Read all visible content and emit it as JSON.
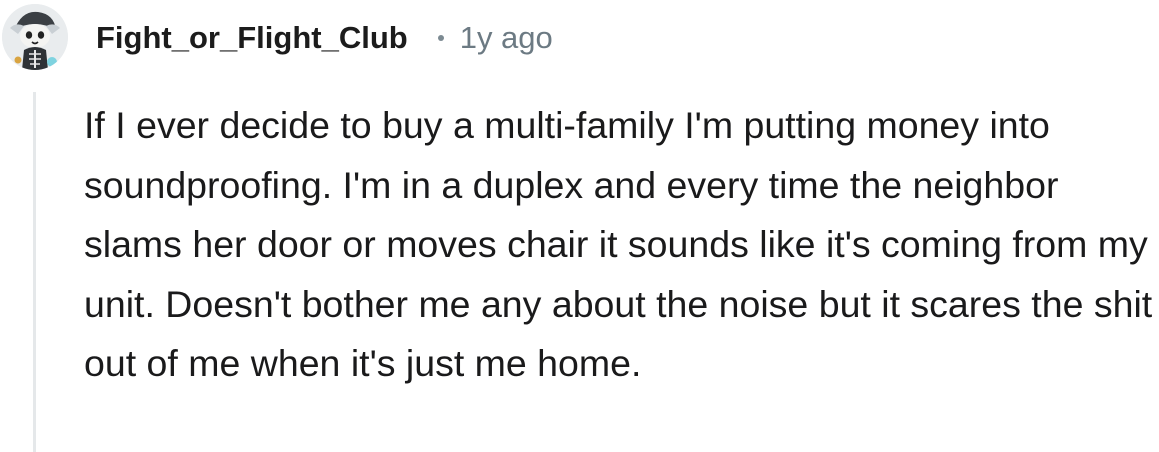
{
  "comment": {
    "username": "Fight_or_Flight_Club",
    "timestamp": "1y ago",
    "avatar_icon": "snoo-avatar-icon",
    "body": "If I ever decide to buy a multi-family I'm putting money into soundproofing. I'm in a duplex and every time the neighbor slams her door or moves chair it sounds like it's coming from my unit. Doesn't bother me any about the noise but it scares the shit out of me when it's just me home."
  },
  "colors": {
    "username": "#1c1c1c",
    "timestamp": "#6c7a83",
    "body": "#1a1a1b",
    "thread_line": "#e5e8ea"
  }
}
